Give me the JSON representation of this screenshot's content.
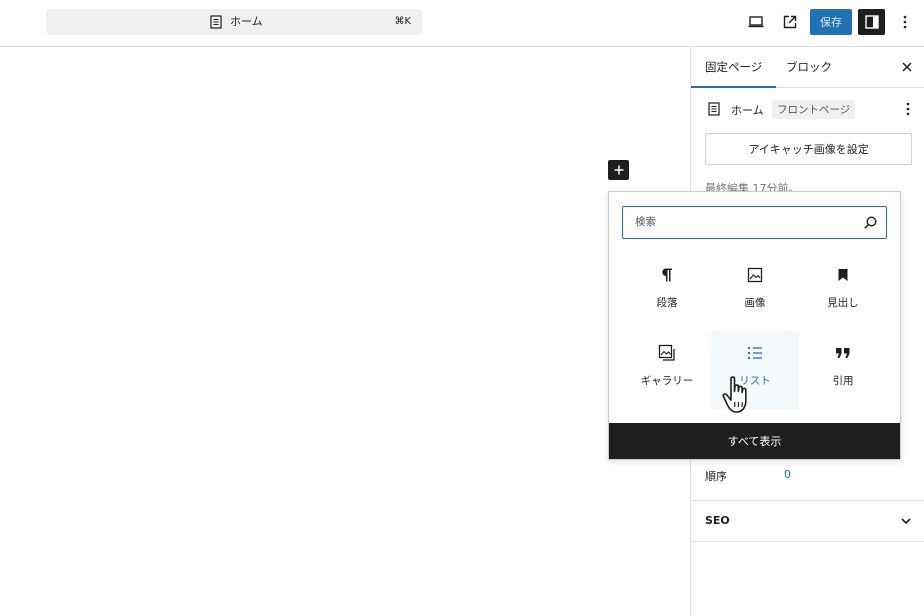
{
  "topbar": {
    "command_title": "ホーム",
    "shortcut": "⌘K",
    "save_label": "保存"
  },
  "sidebar": {
    "tabs": [
      {
        "label": "固定ページ",
        "active": true
      },
      {
        "label": "ブロック",
        "active": false
      }
    ],
    "page_name": "ホーム",
    "page_badge": "フロントページ",
    "featured_image_button": "アイキャッチ画像を設定",
    "last_edited": "最終編集 17分前。",
    "order_label": "順序",
    "order_value": "0",
    "seo_label": "SEO"
  },
  "inserter": {
    "search_placeholder": "検索",
    "blocks": [
      {
        "label": "段落",
        "icon": "paragraph-icon"
      },
      {
        "label": "画像",
        "icon": "image-icon"
      },
      {
        "label": "見出し",
        "icon": "heading-icon"
      },
      {
        "label": "ギャラリー",
        "icon": "gallery-icon"
      },
      {
        "label": "リスト",
        "icon": "list-icon"
      },
      {
        "label": "引用",
        "icon": "quote-icon"
      }
    ],
    "show_all_label": "すべて表示"
  },
  "colors": {
    "accent": "#2271b1",
    "dark": "#1e1e1e",
    "border": "#e0e0e0"
  }
}
